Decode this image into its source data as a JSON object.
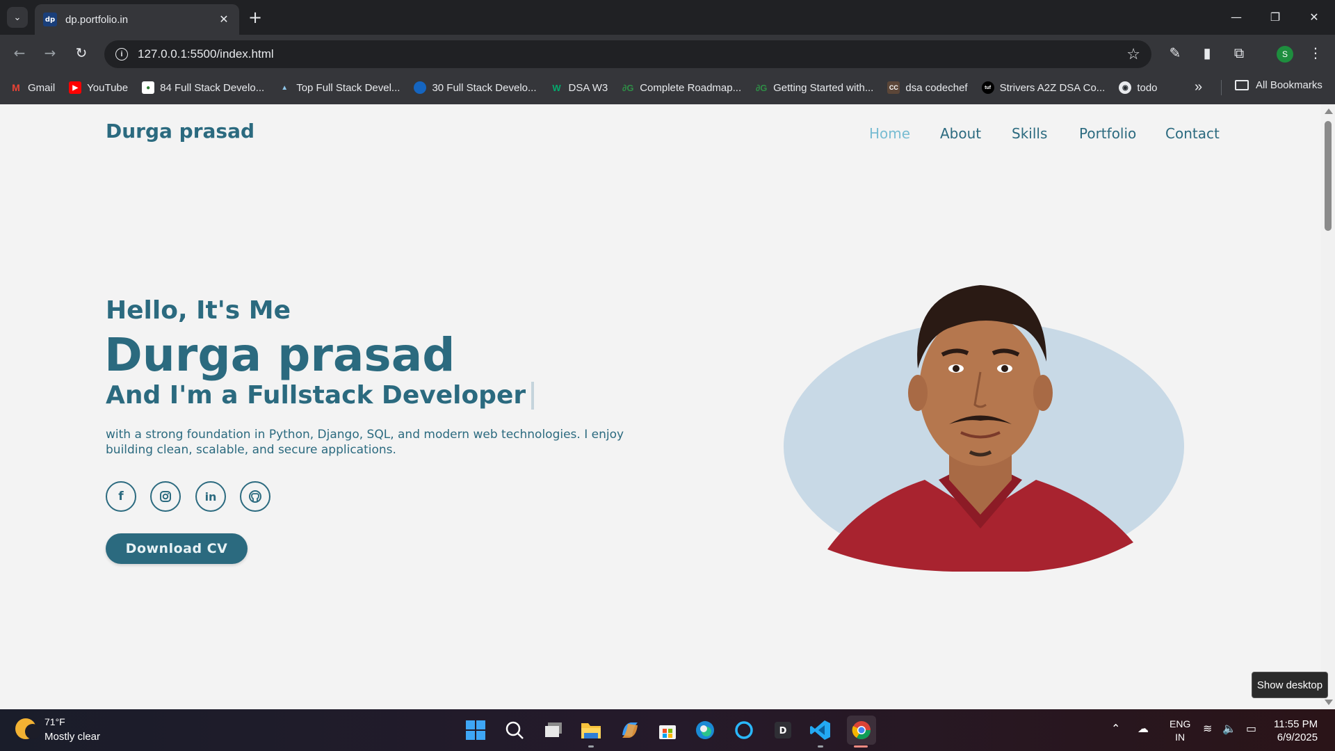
{
  "browser": {
    "tab_title": "dp.portfolio.in",
    "url": "127.0.0.1:5500/index.html",
    "new_tab_symbol": "+",
    "bookmarks": [
      {
        "label": "Gmail",
        "icon": "gmail-icon",
        "color": "#ea4335",
        "glyph": "M"
      },
      {
        "label": "YouTube",
        "icon": "youtube-icon",
        "color": "#ff0000",
        "glyph": "▶"
      },
      {
        "label": "84 Full Stack Develo...",
        "icon": "site-icon",
        "color": "#2e7d32",
        "glyph": "●"
      },
      {
        "label": "Top Full Stack Devel...",
        "icon": "mountain-icon",
        "color": "#4a90c2",
        "glyph": "▲"
      },
      {
        "label": "30 Full Stack Develo...",
        "icon": "globe-icon",
        "color": "#1565c0",
        "glyph": "●"
      },
      {
        "label": "DSA W3",
        "icon": "w3-icon",
        "color": "#04aa6d",
        "glyph": "W"
      },
      {
        "label": "Complete Roadmap...",
        "icon": "gfg-icon",
        "color": "#2f8d46",
        "glyph": "∂"
      },
      {
        "label": "Getting Started with...",
        "icon": "gfg-icon",
        "color": "#2f8d46",
        "glyph": "∂"
      },
      {
        "label": "dsa codechef",
        "icon": "codechef-icon",
        "color": "#5b4638",
        "glyph": "CC"
      },
      {
        "label": "Strivers A2Z DSA Co...",
        "icon": "tuf-icon",
        "color": "#111111",
        "glyph": "tuf"
      },
      {
        "label": "todo",
        "icon": "github-icon",
        "color": "#24292e",
        "glyph": "◉"
      }
    ],
    "all_bookmarks": "All Bookmarks",
    "profile_initial": "S"
  },
  "site": {
    "logo": "Durga prasad",
    "nav": [
      "Home",
      "About",
      "Skills",
      "Portfolio",
      "Contact"
    ],
    "active_nav": "Home",
    "greeting": "Hello, It's Me",
    "name": "Durga prasad",
    "role": "And I'm a Fullstack Developer",
    "description": "with a strong foundation in Python, Django, SQL, and modern web technologies. I enjoy building clean, scalable, and secure applications.",
    "social": [
      {
        "name": "facebook-icon",
        "glyph": "f"
      },
      {
        "name": "instagram-icon",
        "glyph": "◙"
      },
      {
        "name": "linkedin-icon",
        "glyph": "in"
      },
      {
        "name": "github-icon",
        "glyph": "◉"
      }
    ],
    "cta": "Download CV",
    "colors": {
      "primary": "#2b6a7f",
      "active_nav": "#78bcd2",
      "background": "#f3f3f3",
      "photo_blob": "#c8d9e6"
    }
  },
  "tooltip": "Show desktop",
  "taskbar": {
    "temperature": "71°F",
    "condition": "Mostly clear",
    "language": "ENG",
    "region": "IN",
    "time": "11:55 PM",
    "date": "6/9/2025"
  }
}
